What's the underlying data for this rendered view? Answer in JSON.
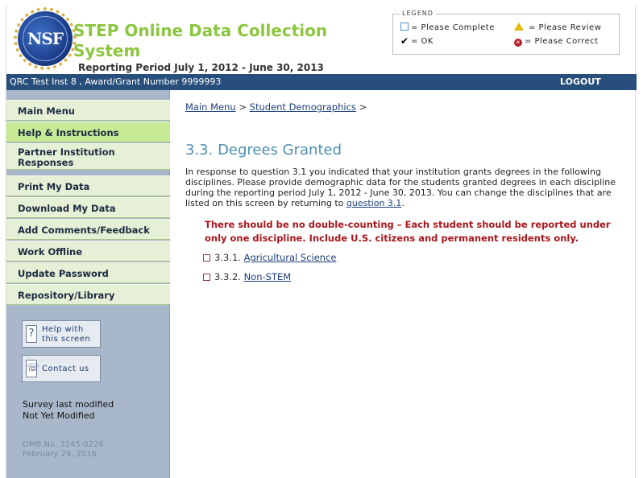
{
  "header": {
    "logo_text": "NSF",
    "title": "STEP Online Data Collection System",
    "period": "Reporting Period July 1, 2012 - June 30, 2013"
  },
  "legend": {
    "title": "LEGEND",
    "complete": "= Please Complete",
    "review": "= Please Review",
    "ok": "= OK",
    "correct": "= Please Correct"
  },
  "topbar": {
    "institution": "QRC Test Inst 8 , Award/Grant Number 9999993",
    "logout": "LOGOUT"
  },
  "sidebar": {
    "items": [
      {
        "label": "Main Menu"
      },
      {
        "label": "Help & Instructions"
      },
      {
        "label": "Partner Institution Responses"
      },
      {
        "label": "Print My Data"
      },
      {
        "label": "Download My Data"
      },
      {
        "label": "Add Comments/Feedback"
      },
      {
        "label": "Work Offline"
      },
      {
        "label": "Update Password"
      },
      {
        "label": "Repository/Library"
      }
    ],
    "help_line1": "Help with",
    "help_line2": "this screen",
    "contact": "Contact us",
    "survey_label": "Survey last modified",
    "survey_value": "Not Yet Modified",
    "omb_line1": "OMB No. 3145-0226",
    "omb_line2": "February 29, 2016"
  },
  "main": {
    "crumb_main": "Main Menu",
    "crumb_sep1": " > ",
    "crumb_current": "Student Demographics",
    "crumb_sep2": " >",
    "title": "3.3. Degrees Granted",
    "intro_text": "In response to question 3.1 you indicated that your institution grants degrees in the following disciplines. Please provide demographic data for the students granted degrees in each discipline during the reporting period July 1, 2012 - June 30, 2013. You can change the disciplines that are listed on this screen by returning to ",
    "intro_link": "question 3.1",
    "intro_end": ".",
    "warning": "There should be no double-counting – Each student should be reported under only one discipline. Include U.S. citizens and permanent residents only.",
    "disciplines": [
      {
        "num": "3.3.1.",
        "label": "Agricultural Science"
      },
      {
        "num": "3.3.2.",
        "label": "Non-STEM"
      }
    ]
  }
}
